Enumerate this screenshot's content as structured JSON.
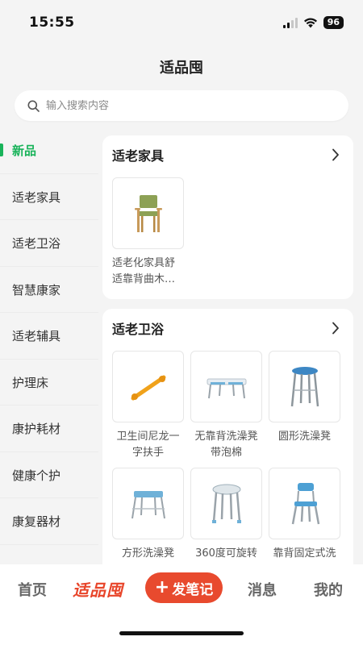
{
  "status": {
    "time": "15:55",
    "battery": "96"
  },
  "title": "适品囤",
  "search": {
    "placeholder": "输入搜索内容"
  },
  "sidebar": {
    "items": [
      {
        "label": "新品"
      },
      {
        "label": "适老家具"
      },
      {
        "label": "适老卫浴"
      },
      {
        "label": "智慧康家"
      },
      {
        "label": "适老辅具"
      },
      {
        "label": "护理床"
      },
      {
        "label": "康护耗材"
      },
      {
        "label": "健康个护"
      },
      {
        "label": "康复器材"
      }
    ]
  },
  "sections": [
    {
      "title": "适老家具",
      "products": [
        {
          "name": "适老化家具舒适靠背曲木…"
        }
      ]
    },
    {
      "title": "适老卫浴",
      "products": [
        {
          "name": "卫生间尼龙一字扶手"
        },
        {
          "name": "无靠背洗澡凳带泡棉"
        },
        {
          "name": "圆形洗澡凳"
        },
        {
          "name": "方形洗澡凳"
        },
        {
          "name": "360度可旋转"
        },
        {
          "name": "靠背固定式洗"
        }
      ]
    }
  ],
  "nav": {
    "home": "首页",
    "brand": "适品囤",
    "post": "发笔记",
    "messages": "消息",
    "mine": "我的"
  },
  "colors": {
    "accent": "#19b35a",
    "brand": "#e84a2e"
  }
}
